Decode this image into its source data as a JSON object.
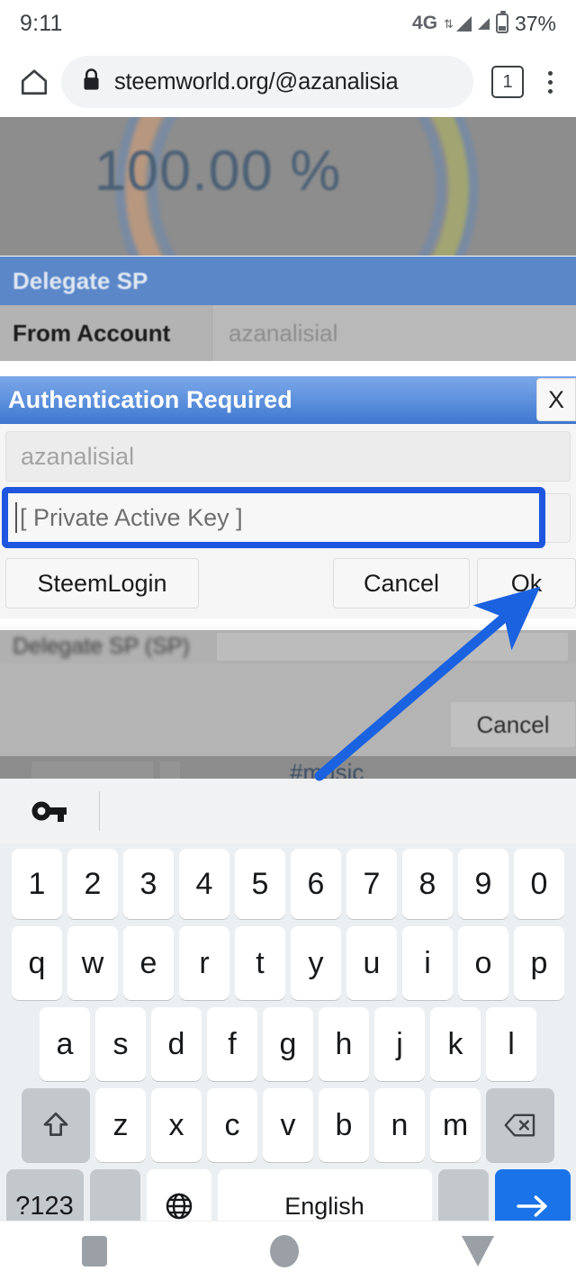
{
  "status_bar": {
    "time": "9:11",
    "network": "4G",
    "battery_percent": "37%",
    "icons": [
      "data-transfer-icon",
      "signal-bars-icon",
      "signal-bars-icon",
      "battery-icon"
    ]
  },
  "browser": {
    "home_icon": "home-icon",
    "lock_icon": "lock-icon",
    "url": "steemworld.org/@azanalisia",
    "tab_count": "1",
    "menu_icon": "kebab-menu-icon"
  },
  "page": {
    "gauge_value": "100.00 %",
    "section_title": "Delegate SP",
    "from_account_label": "From Account",
    "from_account_value": "azanalisial",
    "background_cancel_label": "Cancel",
    "tag": "#music"
  },
  "auth_dialog": {
    "title": "Authentication Required",
    "close_label": "X",
    "username_value": "azanalisial",
    "key_placeholder": "[ Private Active Key ]",
    "steemlogin_label": "SteemLogin",
    "cancel_label": "Cancel",
    "ok_label": "Ok"
  },
  "annotation": {
    "arrow": "arrow-pointing-to-ok-button",
    "color": "#1b62e0"
  },
  "keyboard": {
    "suggestion_icon": "key-icon",
    "row_numbers": [
      "1",
      "2",
      "3",
      "4",
      "5",
      "6",
      "7",
      "8",
      "9",
      "0"
    ],
    "row_top": [
      "q",
      "w",
      "e",
      "r",
      "t",
      "y",
      "u",
      "i",
      "o",
      "p"
    ],
    "row_home": [
      "a",
      "s",
      "d",
      "f",
      "g",
      "h",
      "j",
      "k",
      "l"
    ],
    "row_bottom": [
      "z",
      "x",
      "c",
      "v",
      "b",
      "n",
      "m"
    ],
    "shift_icon": "shift-arrow-icon",
    "backspace_icon": "backspace-icon",
    "symbols_label": "?123",
    "comma_label": ",",
    "globe_icon": "globe-icon",
    "space_label": "English",
    "period_label": ".",
    "enter_icon": "arrow-right-icon"
  },
  "nav_bar": {
    "recents_icon": "square-recents-icon",
    "home_icon": "circle-home-icon",
    "back_icon": "triangle-back-icon"
  },
  "colors": {
    "accent_blue": "#1a73e8",
    "dialog_header": "#5b8fdc",
    "focus_outline": "#1f56e0",
    "annotation_blue": "#1b62e0"
  }
}
